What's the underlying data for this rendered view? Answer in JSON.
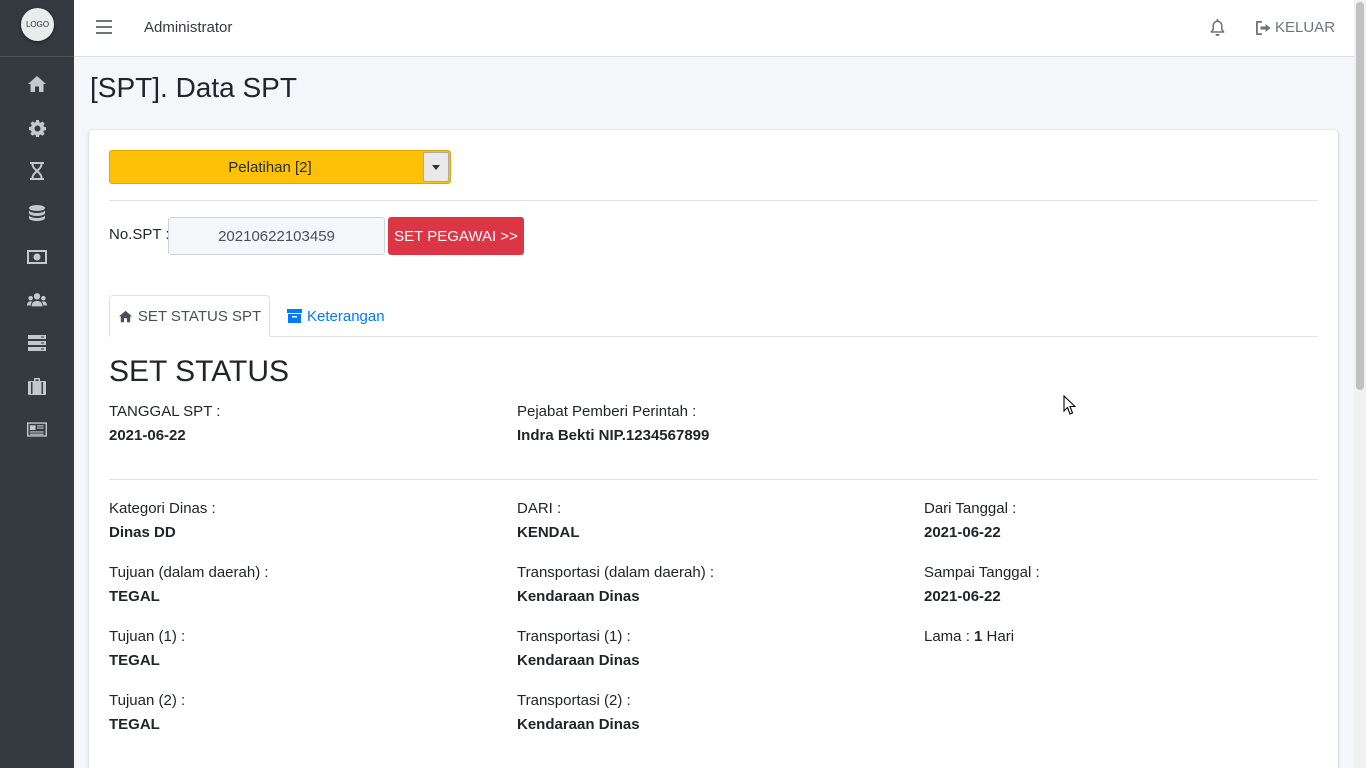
{
  "sidebar": {
    "logo_text": "LOGO",
    "icons": [
      "home-icon",
      "gear-icon",
      "hourglass-icon",
      "database-icon",
      "money-icon",
      "users-icon",
      "server-icon",
      "suitcase-icon",
      "newspaper-icon"
    ]
  },
  "topnav": {
    "user": "Administrator",
    "logout_label": "KELUAR"
  },
  "page": {
    "title": "[SPT]. Data SPT"
  },
  "filter": {
    "selected": "Pelatihan [2]"
  },
  "spt": {
    "label": "No.SPT :",
    "number": "20210622103459",
    "set_pegawai_label": "SET PEGAWAI >>"
  },
  "tabs": {
    "status_label": "SET STATUS SPT",
    "keterangan_label": "Keterangan"
  },
  "status": {
    "heading": "SET STATUS",
    "tanggal_spt_label": "TANGGAL SPT :",
    "tanggal_spt": "2021-06-22",
    "pejabat_label": "Pejabat Pemberi Perintah :",
    "pejabat": "Indra Bekti NIP.1234567899",
    "kategori_label": "Kategori Dinas :",
    "kategori": "Dinas DD",
    "dari_label": "DARI :",
    "dari": "KENDAL",
    "dari_tanggal_label": "Dari Tanggal :",
    "dari_tanggal": "2021-06-22",
    "tujuan_dalam_label": "Tujuan (dalam daerah) :",
    "tujuan_dalam": "TEGAL",
    "transport_dalam_label": "Transportasi (dalam daerah) :",
    "transport_dalam": "Kendaraan Dinas",
    "sampai_tanggal_label": "Sampai Tanggal :",
    "sampai_tanggal": "2021-06-22",
    "tujuan1_label": "Tujuan (1) :",
    "tujuan1": "TEGAL",
    "transport1_label": "Transportasi (1) :",
    "transport1": "Kendaraan Dinas",
    "lama_label": "Lama :",
    "lama_value": "1",
    "lama_unit": "Hari",
    "tujuan2_label": "Tujuan (2) :",
    "tujuan2": "TEGAL",
    "transport2_label": "Transportasi (2) :",
    "transport2": "Kendaraan Dinas"
  }
}
